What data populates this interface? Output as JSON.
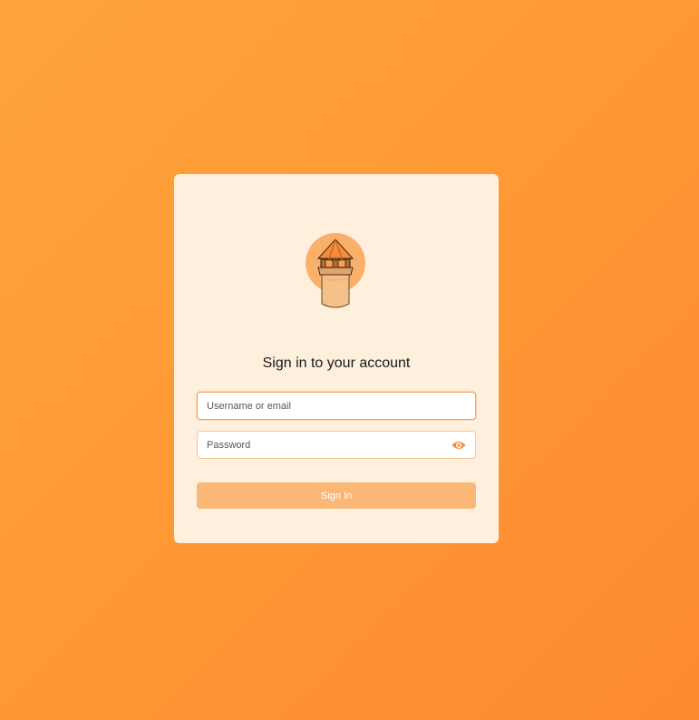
{
  "login": {
    "heading": "Sign in to your account",
    "username_placeholder": "Username or email",
    "password_placeholder": "Password",
    "signin_label": "Sign In",
    "logo_icon": "lighthouse-tower-logo",
    "show_password_icon": "eye-icon"
  },
  "colors": {
    "background_start": "#ffa33a",
    "background_end": "#fd8a31",
    "card": "#fff0dd",
    "accent": "#f58b3c",
    "button": "#fbb775"
  }
}
